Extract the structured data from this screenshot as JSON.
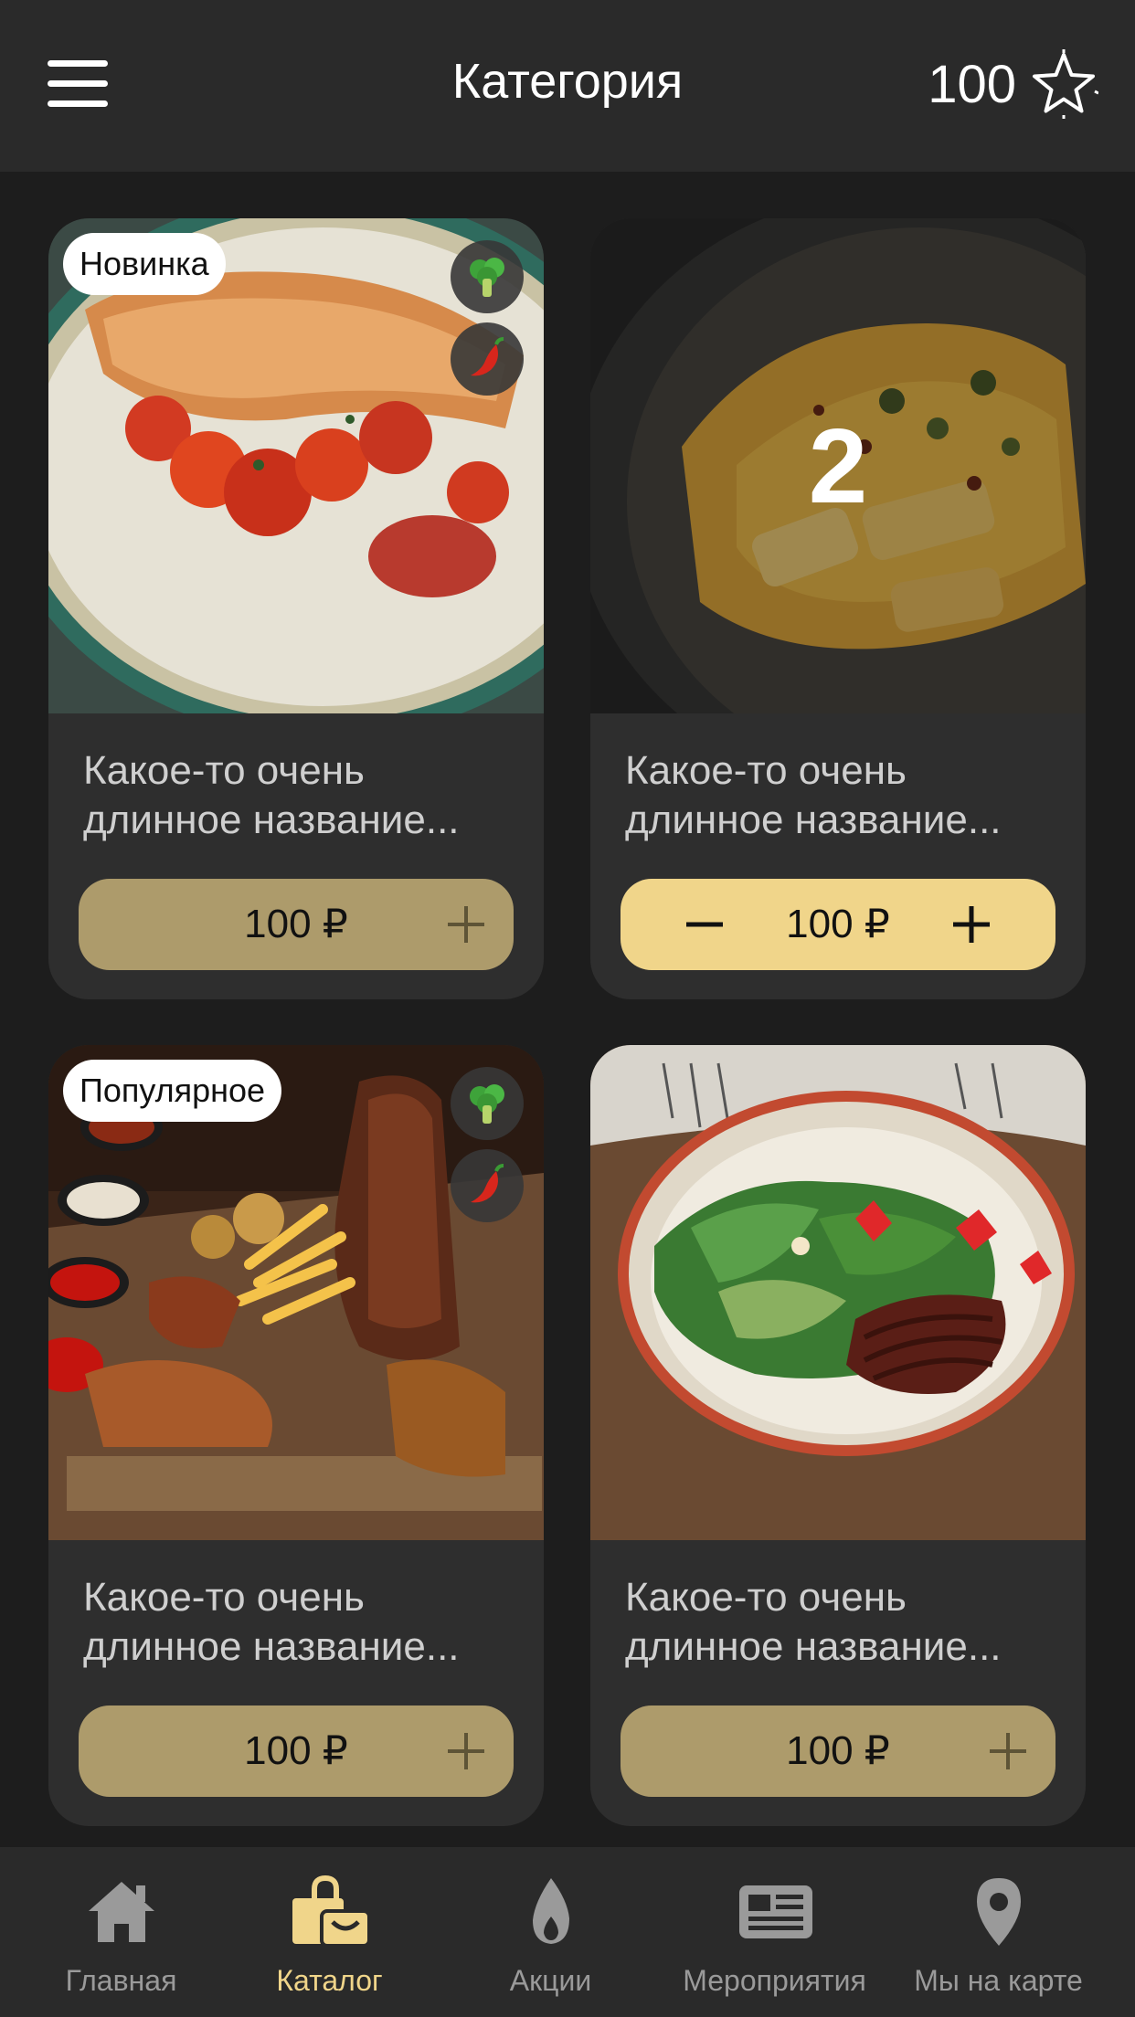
{
  "colors": {
    "accent": "#f0d58a",
    "button_inactive": "#ad9b6b",
    "card_bg": "#2e2e2e",
    "header_bg": "#2a2a2a",
    "page_bg": "#1d1d1d"
  },
  "header": {
    "title": "Категория",
    "points": "100",
    "menu_icon": "hamburger-icon",
    "points_icon": "star-icon"
  },
  "products": [
    {
      "badge": "Новинка",
      "name_line1": "Какое-то очень",
      "name_line2": "длинное название...",
      "price": "100 ₽",
      "image": "salmon-with-tomatoes",
      "diet_icons": [
        "broccoli-icon",
        "chili-pepper-icon"
      ]
    },
    {
      "name_line1": "Какое-то очень",
      "name_line2": "длинное название...",
      "price": "100 ₽",
      "quantity": "2",
      "image": "potatoes-with-cheese-sauce"
    },
    {
      "badge": "Популярное",
      "name_line1": "Какое-то очень",
      "name_line2": "длинное название...",
      "price": "100 ₽",
      "image": "meat-platter",
      "diet_icons": [
        "broccoli-icon",
        "chili-pepper-icon"
      ]
    },
    {
      "name_line1": "Какое-то очень",
      "name_line2": "длинное название...",
      "price": "100 ₽",
      "image": "salad-with-duck"
    }
  ],
  "tabbar": {
    "items": [
      {
        "label": "Главная",
        "icon": "home-icon"
      },
      {
        "label": "Каталог",
        "icon": "shopping-bag-icon",
        "active": true
      },
      {
        "label": "Акции",
        "icon": "flame-icon"
      },
      {
        "label": "Мероприятия",
        "icon": "newspaper-icon"
      },
      {
        "label": "Мы на карте",
        "icon": "map-pin-icon"
      }
    ]
  }
}
